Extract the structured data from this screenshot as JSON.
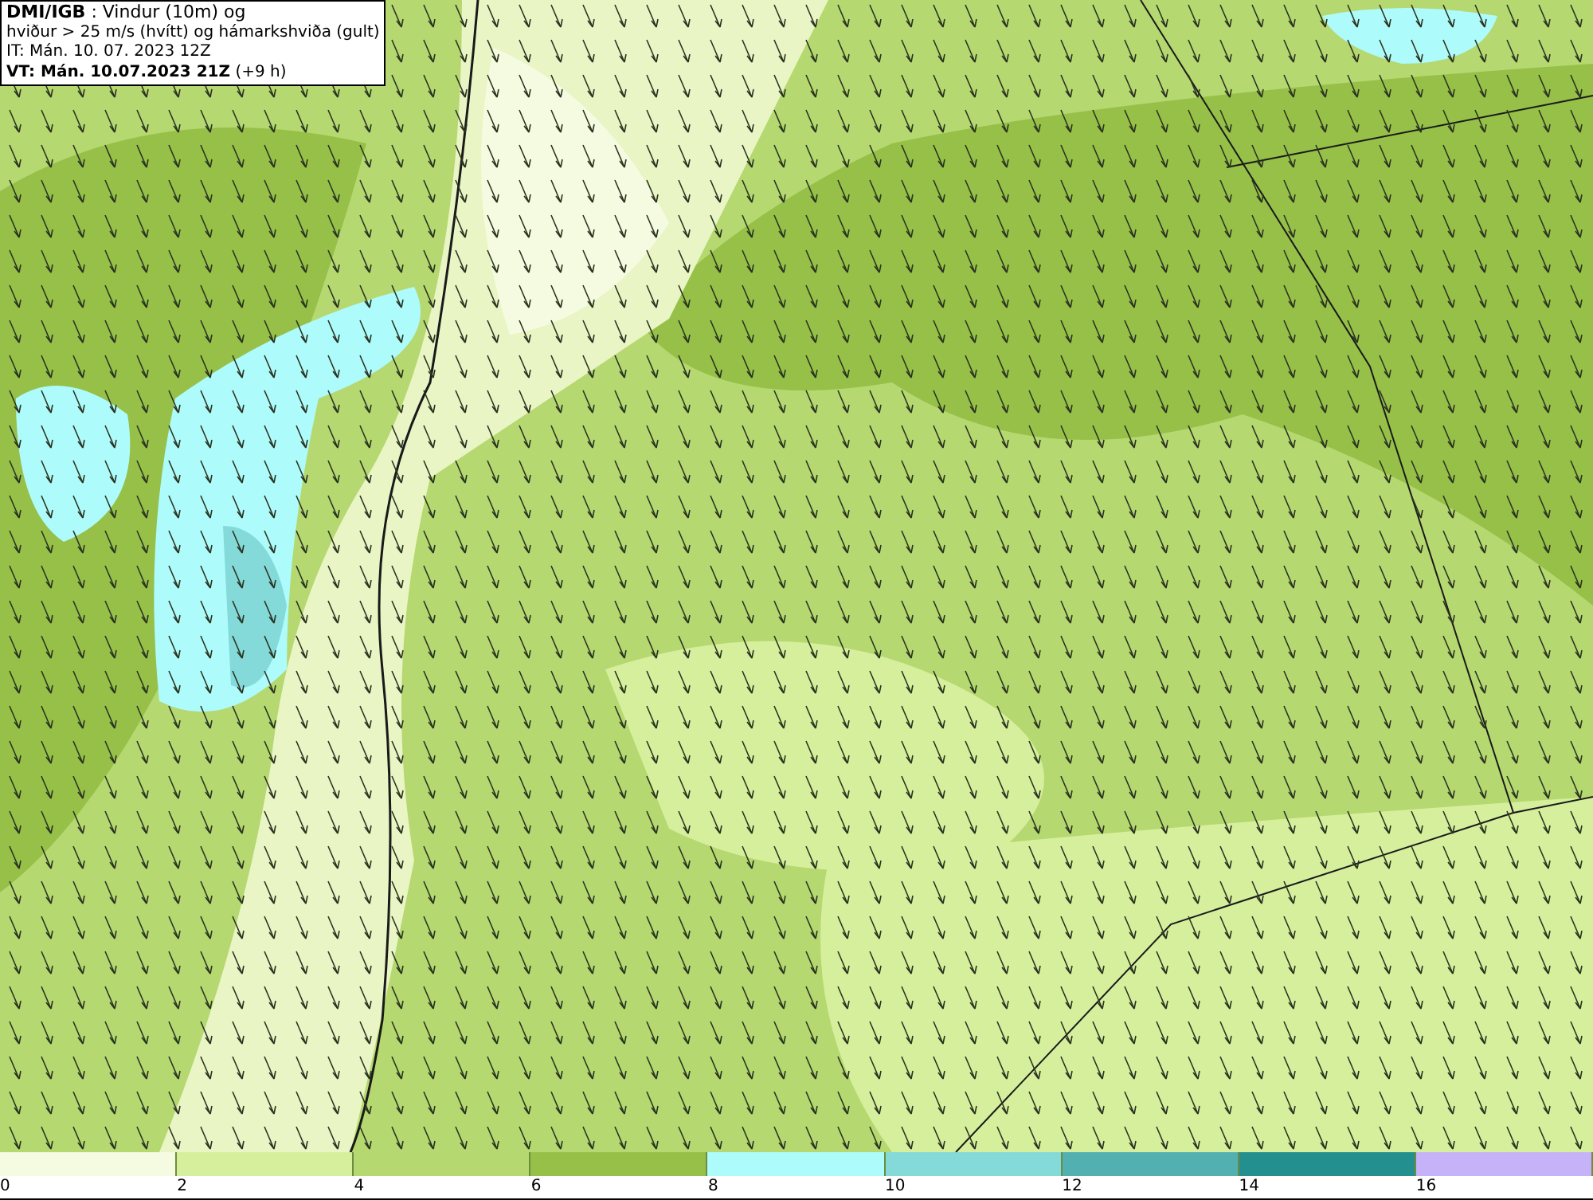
{
  "title_box": {
    "lines": [
      "**DMI/IGB** : Vindur (10m) og",
      "hviður > 25 m/s (hvítt) og hámarkshviða (gult)",
      "IT: Mán. 10. 07. 2023 12Z",
      "**VT: Mán. 10.07.2023 21Z** (+9 h)"
    ]
  },
  "legend": {
    "segments": [
      {
        "color": "#f5fbe0"
      },
      {
        "color": "#d6ef9c"
      },
      {
        "color": "#b5d870"
      },
      {
        "color": "#96c048"
      },
      {
        "color": "#aefbfc"
      },
      {
        "color": "#84d9d9"
      },
      {
        "color": "#52b0b0"
      },
      {
        "color": "#248f8f"
      },
      {
        "color": "#c6b2f8"
      }
    ],
    "ticks": [
      "0",
      "2",
      "4",
      "6",
      "8",
      "10",
      "12",
      "14",
      "16"
    ]
  }
}
